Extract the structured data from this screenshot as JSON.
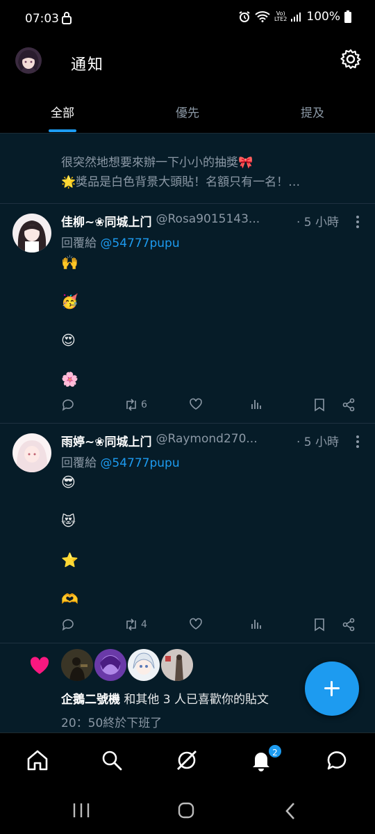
{
  "status_bar": {
    "time": "07:03",
    "lte": "Vo)\nLTE2",
    "battery": "100%"
  },
  "header": {
    "title": "通知"
  },
  "tabs": [
    {
      "label": "全部",
      "active": true
    },
    {
      "label": "優先",
      "active": false
    },
    {
      "label": "提及",
      "active": false
    }
  ],
  "snippet": {
    "line1": "很突然地想要來辦一下小小的抽獎🎀",
    "line2": "🌟獎品是白色背景大頭貼！名額只有一名！…"
  },
  "posts": [
    {
      "name": "佳柳~❀同城上门",
      "handle": "@Rosa9015143...",
      "time": "· 5 小時",
      "reply_prefix": "回覆給",
      "mention": "@54777pupu",
      "emojis": [
        "🙌",
        "🥳",
        "😍",
        "🌸"
      ],
      "retweets": "6"
    },
    {
      "name": "雨婷~❀同城上门",
      "handle": "@Raymond270...",
      "time": "· 5 小時",
      "reply_prefix": "回覆給",
      "mention": "@54777pupu",
      "emojis": [
        "😎",
        "😻",
        "⭐",
        "🫶"
      ],
      "retweets": "4"
    }
  ],
  "likes": {
    "name": "企鵝二號機",
    "rest": " 和其他 3 人已喜歡你的貼文",
    "sub": "20：50終於下班了"
  },
  "nav": {
    "notif_badge": "2"
  },
  "colors": {
    "accent": "#1d9bf0",
    "like": "#f91880",
    "background": "#061c28"
  },
  "icons": [
    "home-icon",
    "search-icon",
    "grok-icon",
    "bell-icon",
    "messages-icon",
    "settings-gear-icon",
    "compose-plus-icon"
  ]
}
